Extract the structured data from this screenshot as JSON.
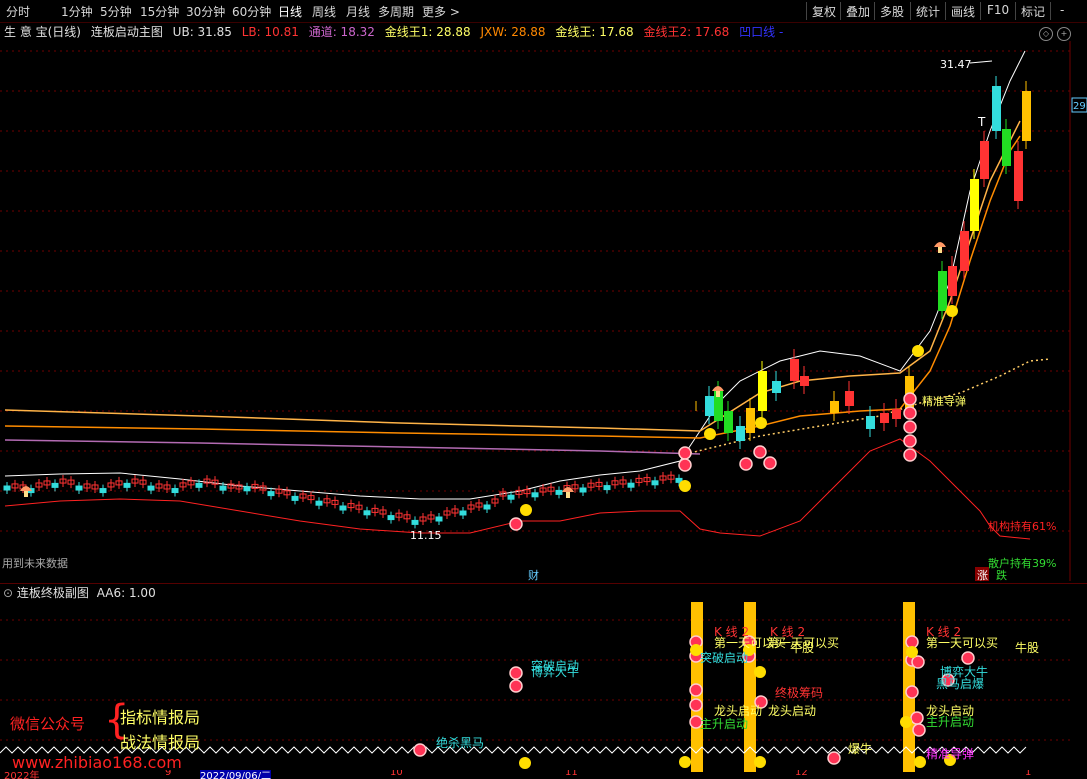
{
  "toolbar": {
    "periods": [
      "分时",
      "1分钟",
      "5分钟",
      "15分钟",
      "30分钟",
      "60分钟",
      "日线",
      "周线",
      "月线",
      "多周期",
      "更多 >"
    ],
    "active_period": "日线",
    "right_buttons": [
      "复权",
      "叠加",
      "多股",
      "统计",
      "画线",
      "F10",
      "标记",
      "-"
    ]
  },
  "main_header": {
    "stock": "生 意 宝(日线)",
    "indicator": "连板启动主图",
    "ub": "UB: 31.85",
    "lb": "LB: 10.81",
    "tongdao": "通道: 18.32",
    "jxw1": "金线王1: 28.88",
    "jxw_abbr": "JXW: 28.88",
    "jxw": "金线王: 17.68",
    "jxw2": "金线王2: 17.68",
    "aoukou": "凹口线 -"
  },
  "main_chart": {
    "high_label": "31.47",
    "low_label": "11.15",
    "t_label": "T",
    "signal_label": "精准导弹",
    "inst_label": "机构持有61%",
    "retail_label": "散户持有39%",
    "future_data": "用到未来数据",
    "cai_badge": "财",
    "zhang_badge": "涨",
    "die_badge": "跌",
    "price_tag": "29"
  },
  "sub_header": {
    "name": "连板终极副图",
    "aa6": "AA6: 1.00"
  },
  "sub_chart": {
    "labels": [
      {
        "text": "第一天可以买",
        "color": "#ffff66"
      },
      {
        "text": "第一天可以买",
        "color": "#ffff66"
      },
      {
        "text": "第一天可以买",
        "color": "#ffff66"
      },
      {
        "text": "牛股",
        "color": "#ffff66"
      },
      {
        "text": "牛股",
        "color": "#ffff66"
      },
      {
        "text": "突破启动",
        "color": "#33dddd"
      },
      {
        "text": "博弈大牛",
        "color": "#33dddd"
      },
      {
        "text": "博弈大牛",
        "color": "#33dddd"
      },
      {
        "text": "突破启动",
        "color": "#33dddd"
      },
      {
        "text": "龙头启动",
        "color": "#ffff66"
      },
      {
        "text": "龙头启动",
        "color": "#ffff66"
      },
      {
        "text": "龙头启动",
        "color": "#ffff66"
      },
      {
        "text": "终极筹码",
        "color": "#ff3333"
      },
      {
        "text": "主升启动",
        "color": "#33dd33"
      },
      {
        "text": "主升启动",
        "color": "#33dd33"
      },
      {
        "text": "黑马启爆",
        "color": "#33dddd"
      },
      {
        "text": "绝杀黑马",
        "color": "#33dddd"
      },
      {
        "text": "爆牛",
        "color": "#ffff66"
      },
      {
        "text": "精准导弹",
        "color": "#ff33ff"
      },
      {
        "text": "K 线 2",
        "color": "#ff3333"
      },
      {
        "text": "K 线 2",
        "color": "#ff3333"
      },
      {
        "text": "K 线 2",
        "color": "#ff3333"
      }
    ]
  },
  "watermark": {
    "wechat": "微信公众号",
    "line1": "指标情报局",
    "line2": "战法情报局",
    "url": "www.zhibiao168.com"
  },
  "date_axis": {
    "labels": [
      "2022年",
      "9",
      "2022/09/06/二",
      "10",
      "11",
      "12",
      "1"
    ]
  }
}
